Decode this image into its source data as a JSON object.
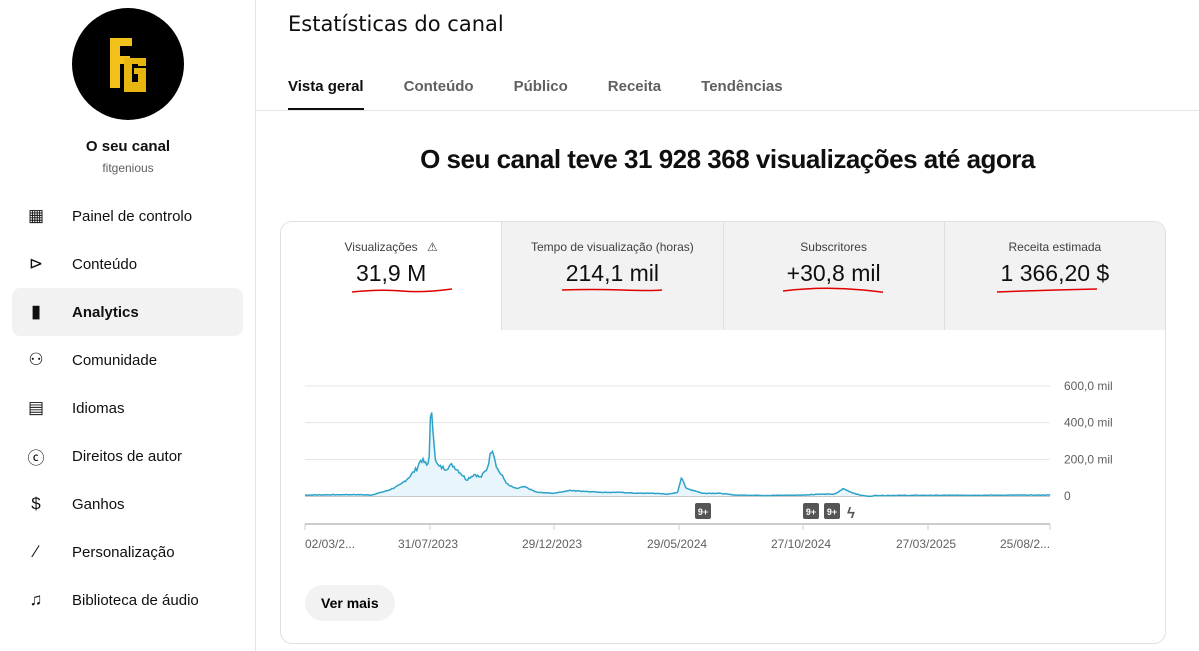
{
  "sidebar": {
    "channel_name": "O seu canal",
    "handle": "fitgenious",
    "logo_text": "FG",
    "items": [
      {
        "label": "Painel de controlo",
        "icon": "dashboard-icon"
      },
      {
        "label": "Conteúdo",
        "icon": "content-icon"
      },
      {
        "label": "Analytics",
        "icon": "analytics-icon"
      },
      {
        "label": "Comunidade",
        "icon": "community-icon"
      },
      {
        "label": "Idiomas",
        "icon": "subtitles-icon"
      },
      {
        "label": "Direitos de autor",
        "icon": "copyright-icon"
      },
      {
        "label": "Ganhos",
        "icon": "dollar-icon"
      },
      {
        "label": "Personalização",
        "icon": "magic-wand-icon"
      },
      {
        "label": "Biblioteca de áudio",
        "icon": "audio-library-icon"
      }
    ]
  },
  "header": {
    "title": "Estatísticas do canal",
    "tabs": [
      "Vista geral",
      "Conteúdo",
      "Público",
      "Receita",
      "Tendências"
    ]
  },
  "headline": "O seu canal teve 31 928 368 visualizações até agora",
  "metrics": [
    {
      "label": "Visualizações",
      "value": "31,9 M"
    },
    {
      "label": "Tempo de visualização (horas)",
      "value": "214,1 mil"
    },
    {
      "label": "Subscritores",
      "value": "+30,8 mil"
    },
    {
      "label": "Receita estimada",
      "value": "1 366,20 $"
    }
  ],
  "more_button": "Ver mais",
  "colors": {
    "line": "#2ea2c9",
    "fill": "#e8f5fa",
    "annotation": "#e00000"
  },
  "chart_data": {
    "type": "area",
    "title": "Visualizações",
    "ylim": [
      0,
      600
    ],
    "yticks": [
      "600,0 mil",
      "400,0 mil",
      "200,0 mil",
      "0"
    ],
    "xticks": [
      "02/03/2...",
      "31/07/2023",
      "29/12/2023",
      "29/05/2024",
      "27/10/2024",
      "27/03/2025",
      "25/08/2..."
    ],
    "x_days_from_start": [
      0,
      60,
      80,
      100,
      115,
      125,
      135,
      140,
      145,
      148,
      150,
      152,
      155,
      158,
      162,
      170,
      178,
      185,
      195,
      205,
      212,
      220,
      226,
      232,
      238,
      245,
      255,
      265,
      280,
      300,
      320,
      340,
      360,
      380,
      400,
      420,
      440,
      450,
      455,
      460,
      470,
      480,
      500,
      520,
      560,
      600,
      620,
      640,
      650,
      660,
      670,
      680,
      690,
      900
    ],
    "values_thousands": [
      5,
      8,
      5,
      30,
      60,
      100,
      150,
      200,
      180,
      160,
      230,
      470,
      350,
      180,
      160,
      150,
      170,
      140,
      90,
      120,
      100,
      150,
      270,
      150,
      110,
      60,
      40,
      50,
      20,
      15,
      30,
      25,
      20,
      20,
      15,
      15,
      10,
      20,
      110,
      40,
      30,
      15,
      15,
      5,
      3,
      5,
      10,
      10,
      40,
      20,
      5,
      -2,
      3,
      5
    ],
    "events": [
      "9+",
      "9+",
      "9+",
      "shorts"
    ]
  }
}
